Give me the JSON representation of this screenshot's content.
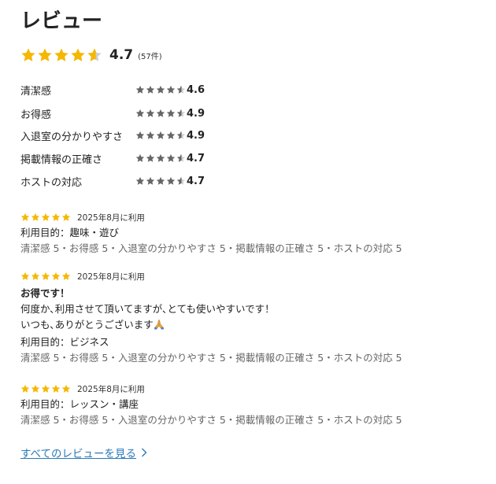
{
  "heading": "レビュー",
  "overall": {
    "score": "4.7",
    "count": "(57件)",
    "rating_value": 4.7,
    "star_color": "#f5b800"
  },
  "category_ratings": [
    {
      "label": "清潔感",
      "score": "4.6"
    },
    {
      "label": "お得感",
      "score": "4.9"
    },
    {
      "label": "入退室の分かりやすさ",
      "score": "4.9"
    },
    {
      "label": "掲載情報の正確さ",
      "score": "4.7"
    },
    {
      "label": "ホストの対応",
      "score": "4.7"
    }
  ],
  "mini_star_color": "#666666",
  "reviews": [
    {
      "stars": 5,
      "date": "2025年8月に利用",
      "purpose": "利用目的：趣味・遊び",
      "breakdown": "清潔感 5・お得感 5・入退室の分かりやすさ 5・掲載情報の正確さ 5・ホストの対応 5"
    },
    {
      "stars": 5,
      "date": "2025年8月に利用",
      "title": "お得です！",
      "body_line1": "何度か､利用させて頂いてますが､とても使いやすいです！",
      "body_line2": "いつも､ありがとうございます",
      "body_emoji": "praying-hands-icon",
      "purpose": "利用目的：ビジネス",
      "breakdown": "清潔感 5・お得感 5・入退室の分かりやすさ 5・掲載情報の正確さ 5・ホストの対応 5"
    },
    {
      "stars": 5,
      "date": "2025年8月に利用",
      "purpose": "利用目的：レッスン・講座",
      "breakdown": "清潔感 5・お得感 5・入退室の分かりやすさ 5・掲載情報の正確さ 5・ホストの対応 5"
    }
  ],
  "review_star_color": "#f5b800",
  "see_all_link": "すべてのレビューを見る",
  "link_color": "#2a7ab8"
}
